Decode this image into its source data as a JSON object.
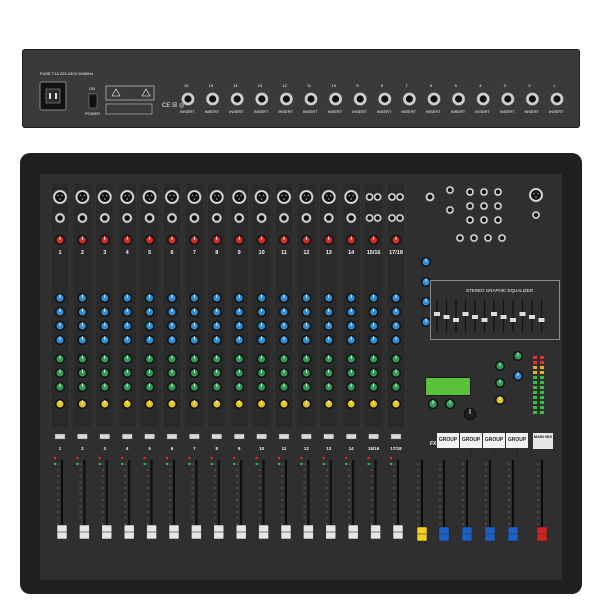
{
  "rear_panel": {
    "fuse_label": "FUSE T1A\n220-240V 50/60Hz",
    "power_on_label": "ON",
    "power_label": "POWER",
    "insert_numbers": [
      "16",
      "15",
      "14",
      "13",
      "12",
      "11",
      "10",
      "9",
      "8",
      "7",
      "6",
      "5",
      "4",
      "3",
      "2",
      "1"
    ],
    "insert_label": "INSERT"
  },
  "top_panel": {
    "channel_numbers": [
      "1",
      "2",
      "3",
      "4",
      "5",
      "6",
      "7",
      "8",
      "9",
      "10",
      "11",
      "12",
      "13",
      "14",
      "15/16",
      "17/18"
    ],
    "fader_numbers": [
      "1",
      "2",
      "3",
      "4",
      "5",
      "6",
      "7",
      "8",
      "9",
      "10",
      "11",
      "12",
      "13",
      "14",
      "15/16",
      "17/18"
    ],
    "eq_title": "STEREO GRAPHIC EQUALIZER",
    "fx_fader_label": "FX",
    "groups": [
      "GROUP 1",
      "GROUP 2",
      "GROUP 3",
      "GROUP 4"
    ],
    "main_mix": "MAIN\nMIX"
  },
  "colors": {
    "rear_body": "#3a3a3a",
    "mixer_body": "#2f2f2f",
    "red_knob": "#d1302a",
    "blue_knob": "#2f8fd6",
    "green_knob": "#2e9d55",
    "yellow_knob": "#e2c21e",
    "fader_fx": "#f2d21c",
    "fader_group": "#1c61c9",
    "fader_main": "#d42121",
    "lcd_green": "#59c23a"
  },
  "icons": {
    "xlr": "xlr-input-icon",
    "jack": "jack-socket-icon",
    "knob": "rotary-knob-icon",
    "iec": "iec-power-socket-icon"
  }
}
